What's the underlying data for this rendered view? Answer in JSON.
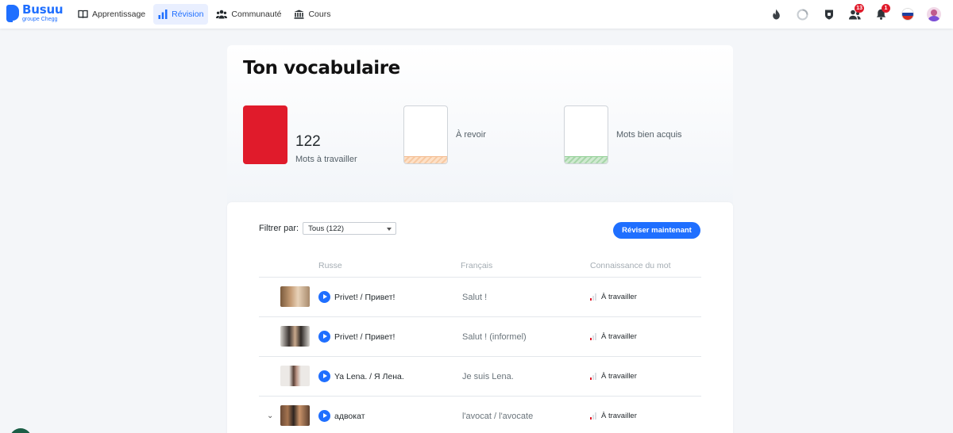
{
  "brand": {
    "name": "Busuu",
    "sub": "groupe Chegg",
    "color": "#1f6fff"
  },
  "nav": [
    {
      "label": "Apprentissage",
      "icon": "book-icon",
      "active": false
    },
    {
      "label": "Révision",
      "icon": "bar-chart-icon",
      "active": true
    },
    {
      "label": "Communauté",
      "icon": "community-icon",
      "active": false
    },
    {
      "label": "Cours",
      "icon": "courses-icon",
      "active": false
    }
  ],
  "header_icons": {
    "friends_badge": "13",
    "notifications_badge": "1"
  },
  "vocab": {
    "title": "Ton vocabulaire",
    "stats": [
      {
        "count": "122",
        "label": "Mots à travailler",
        "color": "#e01b2b"
      },
      {
        "count": "",
        "label": "À revoir",
        "color": "#f7c9a2"
      },
      {
        "count": "",
        "label": "Mots bien acquis",
        "color": "#a7d6a9"
      }
    ]
  },
  "list": {
    "filter_label": "Filtrer par:",
    "filter_value": "Tous (122)",
    "review_button": "Réviser maintenant",
    "columns": [
      "Russe",
      "Français",
      "Connaissance du mot"
    ],
    "rows": [
      {
        "russian": "Privet! / Привет!",
        "french": "Salut !",
        "status": "À travailler",
        "expand": false
      },
      {
        "russian": "Privet! / Привет!",
        "french": "Salut ! (informel)",
        "status": "À travailler",
        "expand": false
      },
      {
        "russian": "Ya Lena. / Я Лена.",
        "french": "Je suis Lena.",
        "status": "À travailler",
        "expand": false
      },
      {
        "russian": "адвокат",
        "french": "l'avocat / l'avocate",
        "status": "À travailler",
        "expand": true
      }
    ]
  }
}
